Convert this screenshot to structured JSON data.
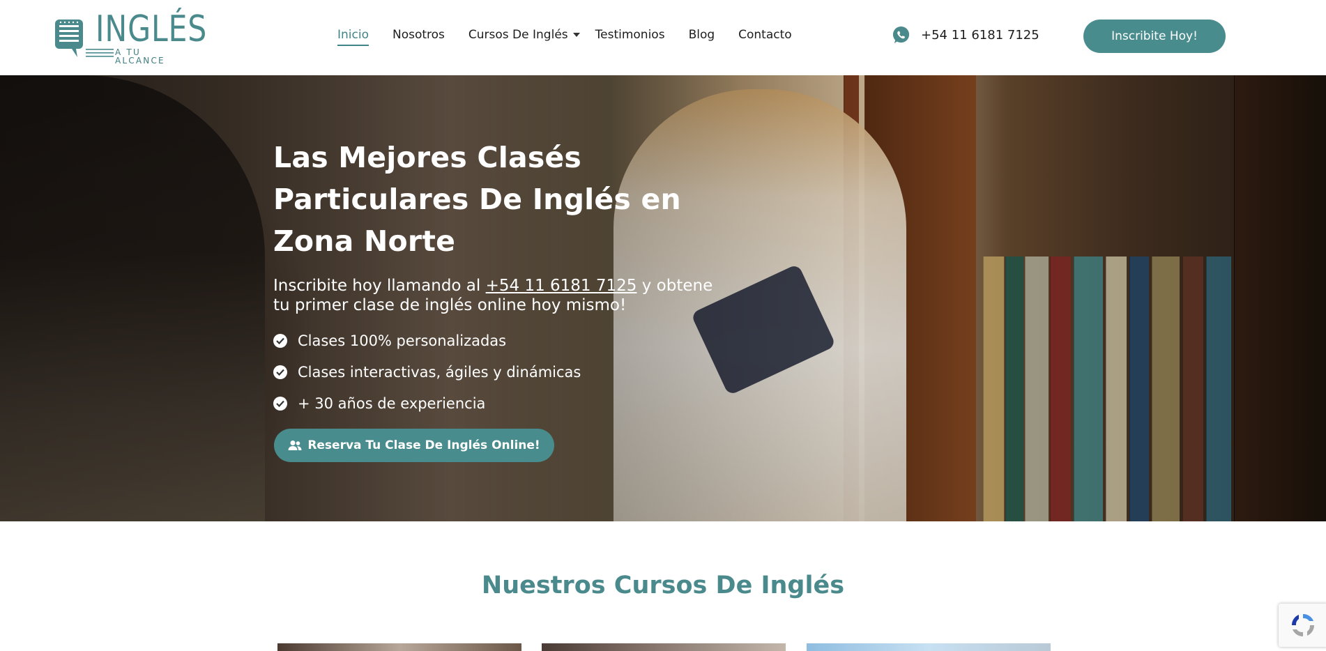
{
  "brand": {
    "logo_word": "INGLÉS",
    "logo_sub": "A TU ALCANCE",
    "accent": "#498c8d"
  },
  "nav": {
    "items": [
      {
        "label": "Inicio",
        "active": true
      },
      {
        "label": "Nosotros"
      },
      {
        "label": "Cursos De Inglés",
        "has_dropdown": true
      },
      {
        "label": "Testimonios"
      },
      {
        "label": "Blog"
      },
      {
        "label": "Contacto"
      }
    ]
  },
  "header": {
    "phone": "+54 11 6181 7125",
    "cta": "Inscribite Hoy!"
  },
  "hero": {
    "title": "Las Mejores Clasés Particulares De Inglés en Zona Norte",
    "sub_before": "Inscribite hoy llamando al ",
    "sub_phone": "+54 11 6181 7125",
    "sub_after": " y obtene tu primer clase de inglés online hoy mismo!",
    "checks": [
      "Clases 100% personalizadas",
      "Clases interactivas, ágiles y dinámicas",
      "+ 30 años de experiencia"
    ],
    "cta": "Reserva Tu Clase De Inglés Online!"
  },
  "courses": {
    "title": "Nuestros Cursos De Inglés"
  }
}
